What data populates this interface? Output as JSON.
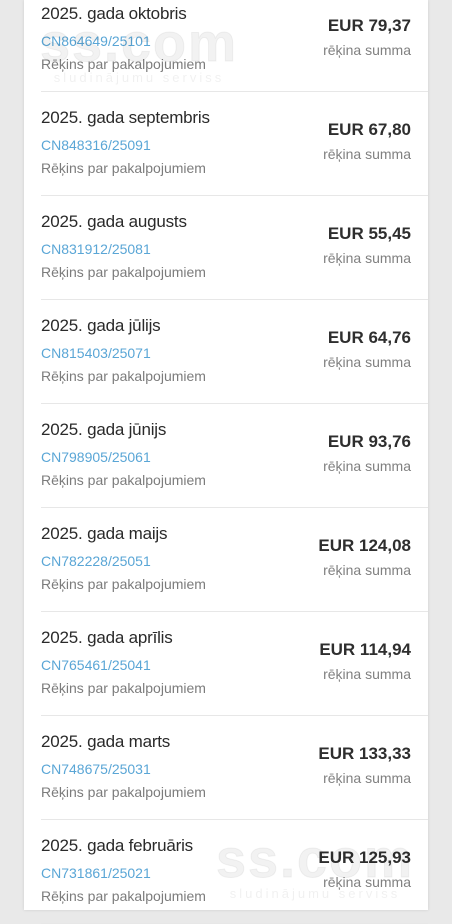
{
  "invoices": [
    {
      "period": "2025. gada oktobris",
      "number": "CN864649/25101",
      "description": "Rēķins par pakalpojumiem",
      "amount": "EUR 79,37",
      "amount_label": "rēķina summa"
    },
    {
      "period": "2025. gada septembris",
      "number": "CN848316/25091",
      "description": "Rēķins par pakalpojumiem",
      "amount": "EUR 67,80",
      "amount_label": "rēķina summa"
    },
    {
      "period": "2025. gada augusts",
      "number": "CN831912/25081",
      "description": "Rēķins par pakalpojumiem",
      "amount": "EUR 55,45",
      "amount_label": "rēķina summa"
    },
    {
      "period": "2025. gada jūlijs",
      "number": "CN815403/25071",
      "description": "Rēķins par pakalpojumiem",
      "amount": "EUR 64,76",
      "amount_label": "rēķina summa"
    },
    {
      "period": "2025. gada jūnijs",
      "number": "CN798905/25061",
      "description": "Rēķins par pakalpojumiem",
      "amount": "EUR 93,76",
      "amount_label": "rēķina summa"
    },
    {
      "period": "2025. gada maijs",
      "number": "CN782228/25051",
      "description": "Rēķins par pakalpojumiem",
      "amount": "EUR 124,08",
      "amount_label": "rēķina summa"
    },
    {
      "period": "2025. gada aprīlis",
      "number": "CN765461/25041",
      "description": "Rēķins par pakalpojumiem",
      "amount": "EUR 114,94",
      "amount_label": "rēķina summa"
    },
    {
      "period": "2025. gada marts",
      "number": "CN748675/25031",
      "description": "Rēķins par pakalpojumiem",
      "amount": "EUR 133,33",
      "amount_label": "rēķina summa"
    },
    {
      "period": "2025. gada februāris",
      "number": "CN731861/25021",
      "description": "Rēķins par pakalpojumiem",
      "amount": "EUR 125,93",
      "amount_label": "rēķina summa"
    }
  ],
  "watermark": {
    "logo": "ss.com",
    "tagline": "sludinājumu serviss"
  },
  "colors": {
    "link": "#5aa6d6",
    "text": "#2a2a2a",
    "muted": "#7c7c7c",
    "background": "#e9e9e9",
    "card": "#ffffff"
  }
}
